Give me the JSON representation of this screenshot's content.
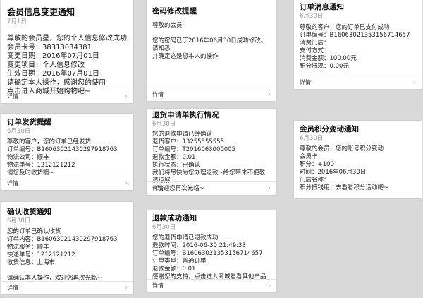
{
  "footer_label": "详情",
  "chevron": "›",
  "cards": [
    {
      "title": "会员信息变更通知",
      "date": "7月1日",
      "content": "尊敬的会员星，您的个人信息修改成功\n会员卡号：38313034381\n变更日期：2016年07月01日\n变更项目：个人信息修改\n生效日期：2016年07月01日\n请确定本人操作，感谢您的使用\n点击进入商城开始购物吧~"
    },
    {
      "title": "密码修改提醒",
      "date": "",
      "content": "尊敬的会员\n\n您的密码已于2016年06月30日成功修改。请知悉\n并确定这是您本人的操作"
    },
    {
      "title": "订单消息通知",
      "date": "6月30日",
      "content": "尊敬的客户，您的订单已支付成功\n订单编号：B1606302135315671465​7\n消费门店：\n支付方式：\n消费金额：100.00元\n积分抵现：0.00元"
    },
    {
      "title": "订单发货提醒",
      "date": "6月30日",
      "content": "尊敬的客户，您的订单已经发货\n订单编号：B1606302143029791876​3\n物流公司：顺丰\n物流单号：1212121212\n请您及时收货噢~"
    },
    {
      "title": "退货申请单执行情况",
      "date": "6月30日",
      "content": "您的退款申请已经确认\n退货客户：13255555555\n订单编号：T2016063000005\n退款金额：0.01\n执行状态：已确认\n我们将尽快为您办理退款~给您带来不便敬请谅解\n~欢迎您再次光临~"
    },
    {
      "title": "会员积分变动通知",
      "date": "6月30日",
      "content": "尊敬的会员，您的账号积分变动\n会员卡：\n积分：+100\n时间：2016年06月30日\n门店名称：\n积分抵钱用，去看看积分活动吧~"
    },
    {
      "title": "确认收货通知",
      "date": "6月30日",
      "content": "您的订单已确认收货\n订单内容：B1606302143029791876​3\n物流服务：顺丰\n快递单号：1212121212\n收货信息：上海市\n\n请确认本人操作，欢迎您再次光临~"
    },
    {
      "title": "退款成功通知",
      "date": "6月30日",
      "content": "您的退货申请已退款成功\n退款时间：2016-06-30 21:49:33\n订单编号：B1606302135315671465​7\n订单类型：普通订单\n退款金额：0.01\n感谢您的支持，点击进入商城看看其他产品~"
    }
  ]
}
